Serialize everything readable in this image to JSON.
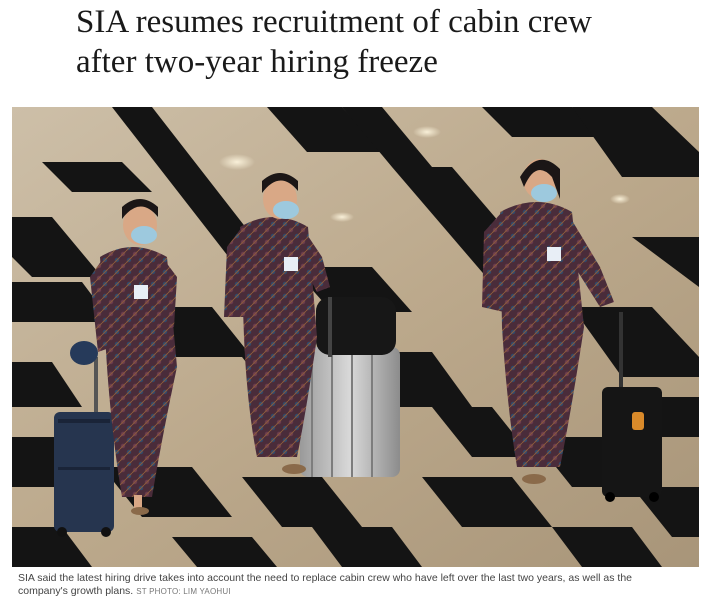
{
  "article": {
    "headline_line1": "SIA resumes recruitment of cabin crew",
    "headline_line2": "after two-year hiring freeze"
  },
  "photo": {
    "caption_line1": "SIA said the latest hiring drive takes into account the need to replace cabin crew who have left over the last two years, as well as the",
    "caption_line2": "company's growth plans.",
    "credit": "ST PHOTO: LIM YAOHUI"
  },
  "colors": {
    "floor_light": "#c3b298",
    "floor_dark": "#141414",
    "kebaya": "#4a2c3a",
    "mask": "#9dc9de"
  }
}
